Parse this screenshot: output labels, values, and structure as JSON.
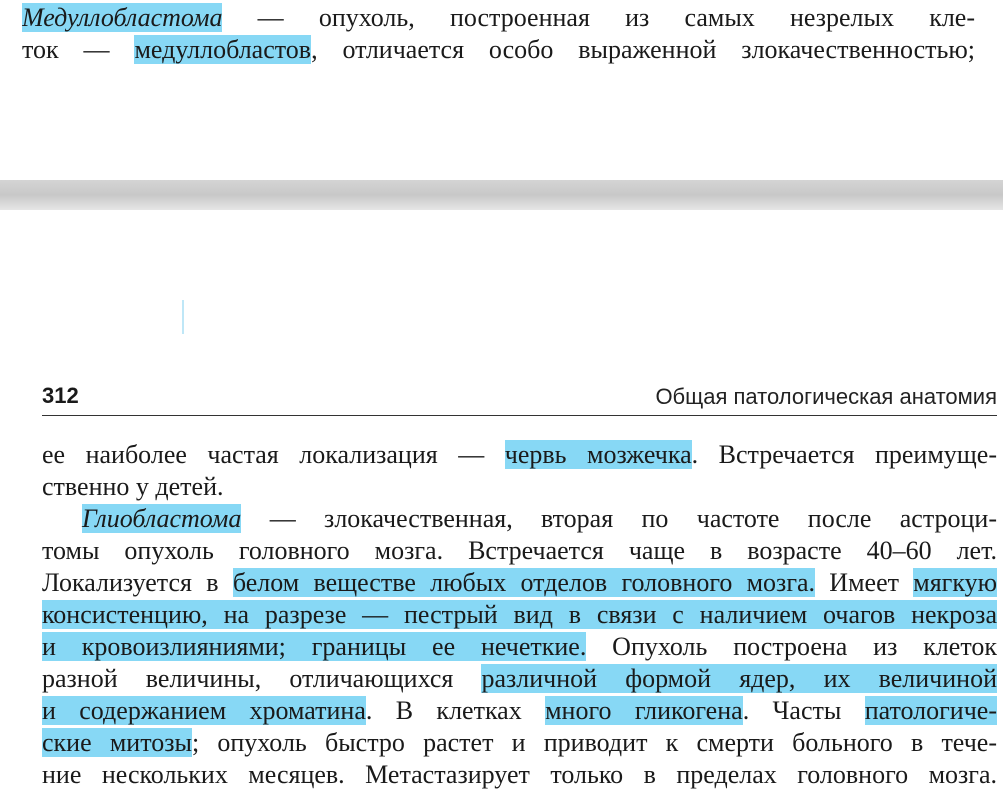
{
  "top": {
    "line1": {
      "term": "Медуллобластома",
      "rest": " — опухоль, построенная из самых незрелых кле-"
    },
    "line2": {
      "pre": "ток — ",
      "hl": "медуллобластов",
      "rest": ", отличается особо выраженной злокачественностью;"
    }
  },
  "header": {
    "page_number": "312",
    "section_title": "Общая патологическая анатомия"
  },
  "body": {
    "l1": {
      "pre": "ее наиболее частая локализация — ",
      "hl": "червь мозжечка",
      "post": ". Встречается преимуще-"
    },
    "l2": {
      "text": "ственно у детей."
    },
    "l3": {
      "term": "Глиобластома",
      "post": " — злокачественная, вторая по частоте после астроци-"
    },
    "l4": {
      "text": "томы опухоль головного мозга. Встречается чаще в возрасте 40–60 лет."
    },
    "l5": {
      "pre": "Локализуется в ",
      "hl": "белом веществе любых отделов головного мозга.",
      "mid": " Имеет ",
      "hl2": "мягкую"
    },
    "l6": {
      "hl": "консистенцию, на разрезе — пестрый вид в связи с наличием очагов некроза"
    },
    "l7": {
      "hl": "и кровоизлияниями; границы ее нечеткие.",
      "post": " Опухоль построена из клеток"
    },
    "l8": {
      "pre": "разной величины, отличающихся ",
      "hl": "различной формой ядер, их величиной"
    },
    "l9": {
      "hl": "и содержанием хроматина",
      "mid": ". В клетках ",
      "hl2": "много гликогена",
      "mid2": ". Часты ",
      "hl3": "патологиче-"
    },
    "l10": {
      "hl": "ские митозы",
      "post": "; опухоль быстро растет и приводит к смерти больного в тече-"
    },
    "l11": {
      "text": "ние нескольких месяцев. Метастазирует только в пределах головного мозга."
    }
  },
  "colors": {
    "highlight": "#87d8f5",
    "separator": "#d0d0d0"
  }
}
